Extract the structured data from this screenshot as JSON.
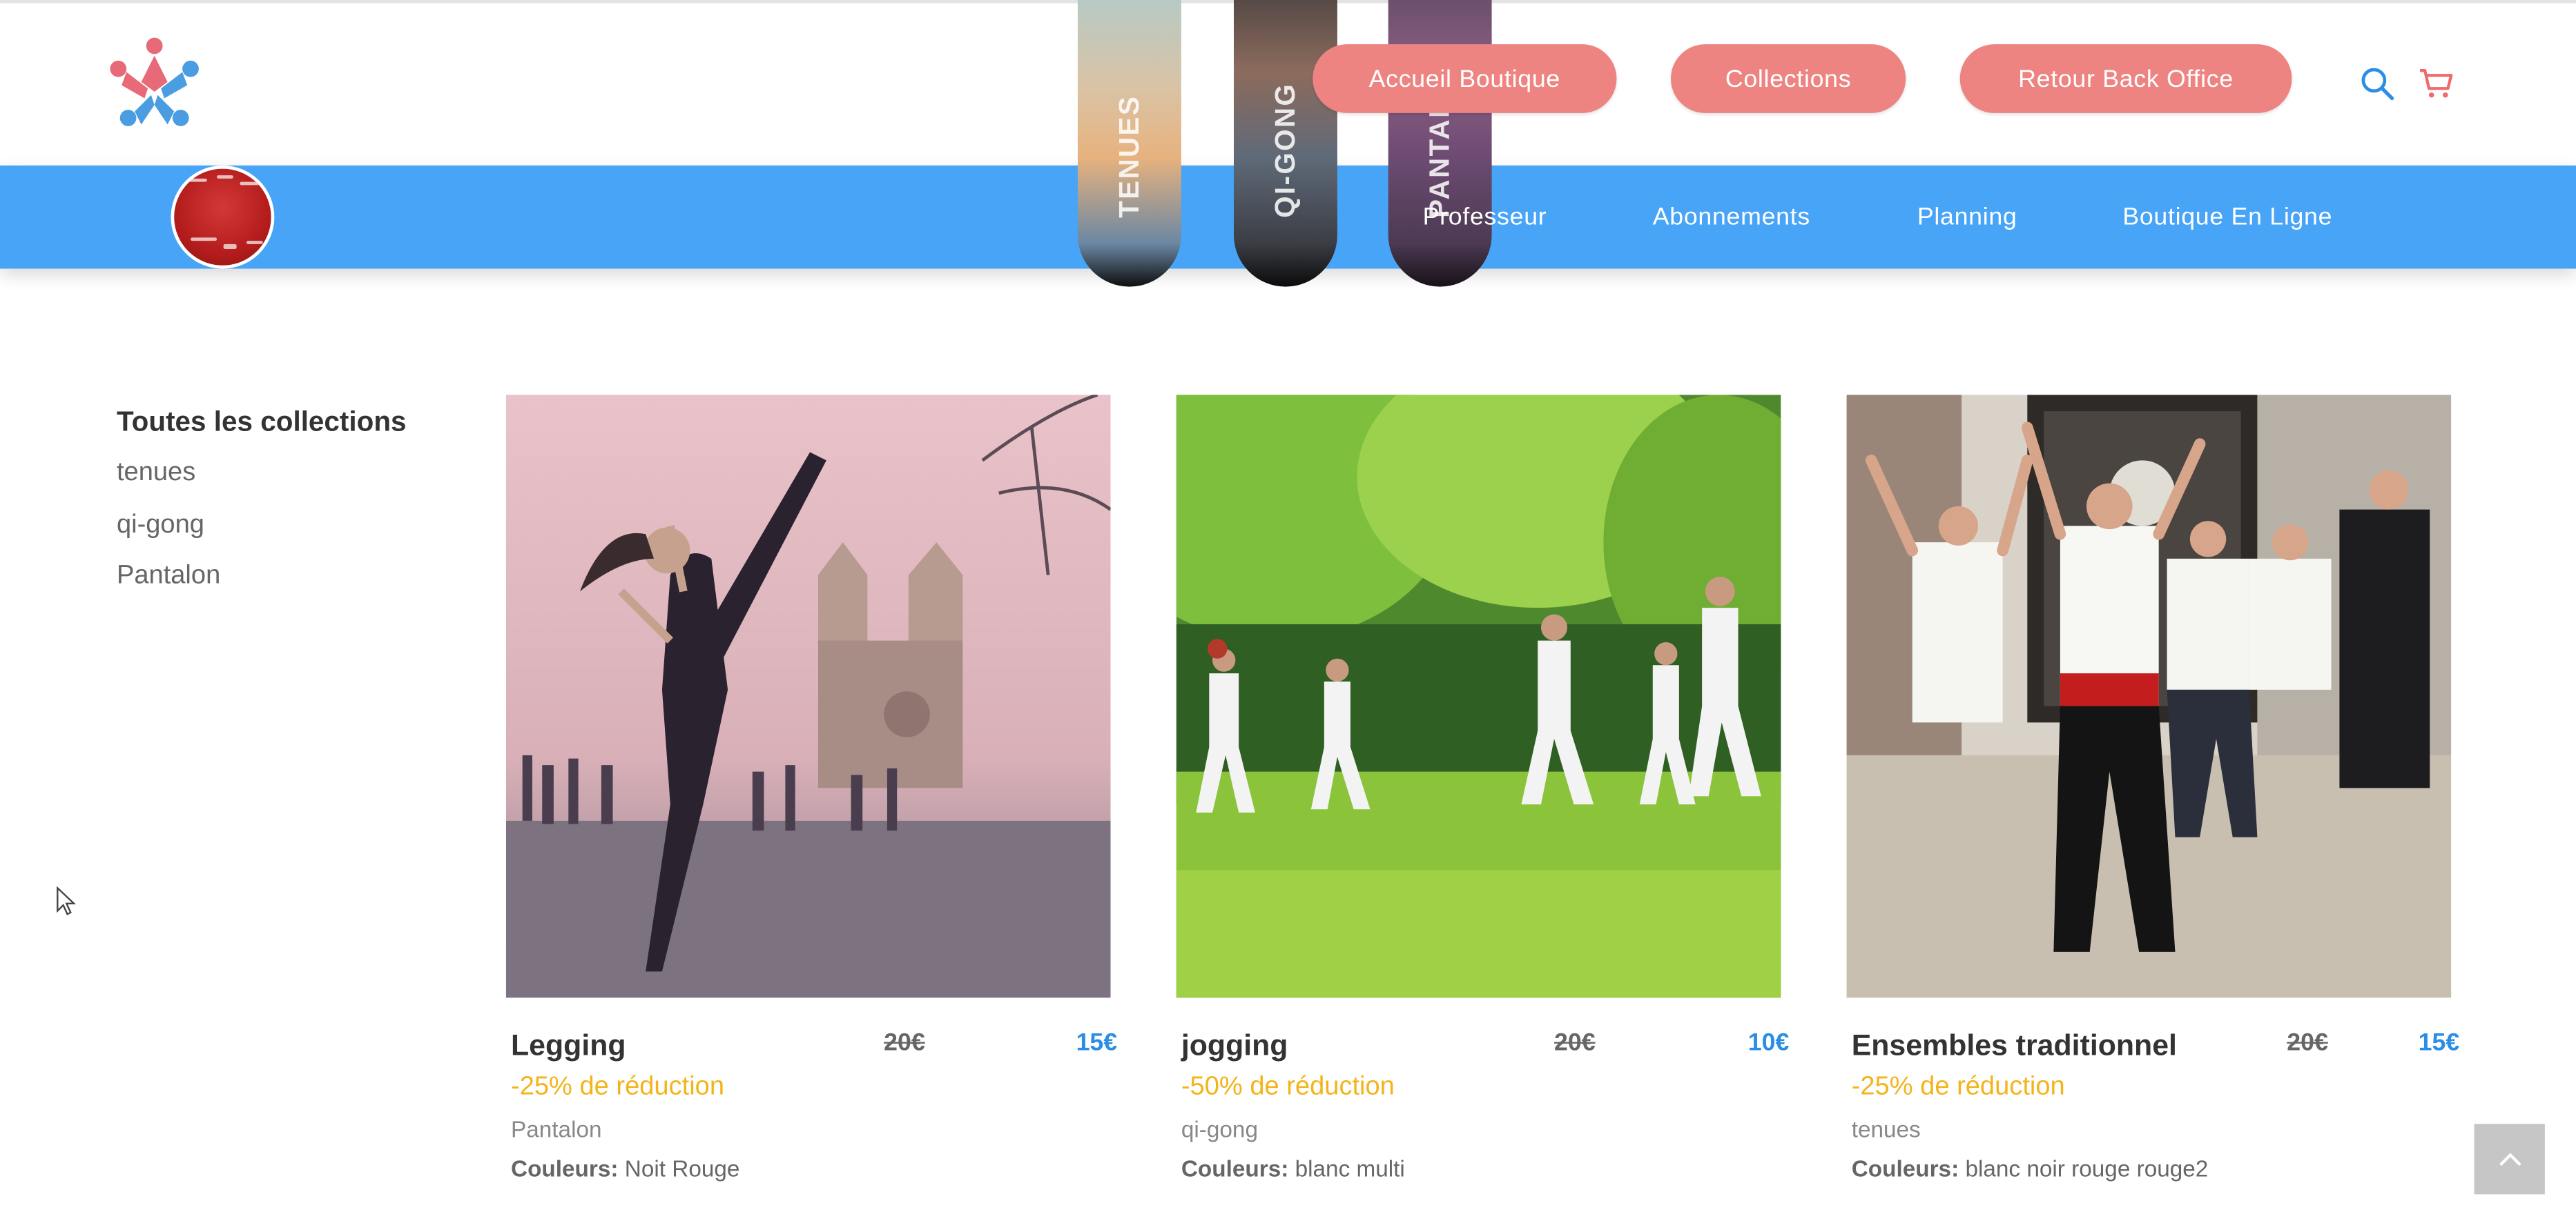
{
  "header": {
    "buttons": [
      {
        "label": "Accueil Boutique"
      },
      {
        "label": "Collections"
      },
      {
        "label": "Retour Back Office"
      }
    ],
    "search_icon": "search-icon",
    "cart_icon": "cart-icon"
  },
  "nav": {
    "links": [
      {
        "label": "Professeur"
      },
      {
        "label": "Abonnements"
      },
      {
        "label": "Planning"
      },
      {
        "label": "Boutique En Ligne"
      }
    ]
  },
  "collection_pills": [
    {
      "label": "TENUES"
    },
    {
      "label": "QI-GONG"
    },
    {
      "label": "PANTALO"
    }
  ],
  "sidebar": {
    "title": "Toutes les collections",
    "items": [
      {
        "label": "tenues"
      },
      {
        "label": "qi-gong"
      },
      {
        "label": "Pantalon"
      }
    ]
  },
  "products": [
    {
      "title": "Legging",
      "old_price": "20€",
      "new_price": "15€",
      "discount": "-25% de réduction",
      "collection": "Pantalon",
      "colors_label": "Couleurs:",
      "colors": "Noit Rouge"
    },
    {
      "title": "jogging",
      "old_price": "20€",
      "new_price": "10€",
      "discount": "-50% de réduction",
      "collection": "qi-gong",
      "colors_label": "Couleurs:",
      "colors": "blanc multi"
    },
    {
      "title": "Ensembles traditionnel",
      "old_price": "20€",
      "new_price": "15€",
      "discount": "-25% de réduction",
      "collection": "tenues",
      "colors_label": "Couleurs:",
      "colors": "blanc noir rouge rouge2"
    }
  ],
  "colors": {
    "header_button": "#ee8482",
    "nav_bar": "#47a4f7",
    "discount": "#f3b41a",
    "new_price": "#2b8ee6"
  }
}
